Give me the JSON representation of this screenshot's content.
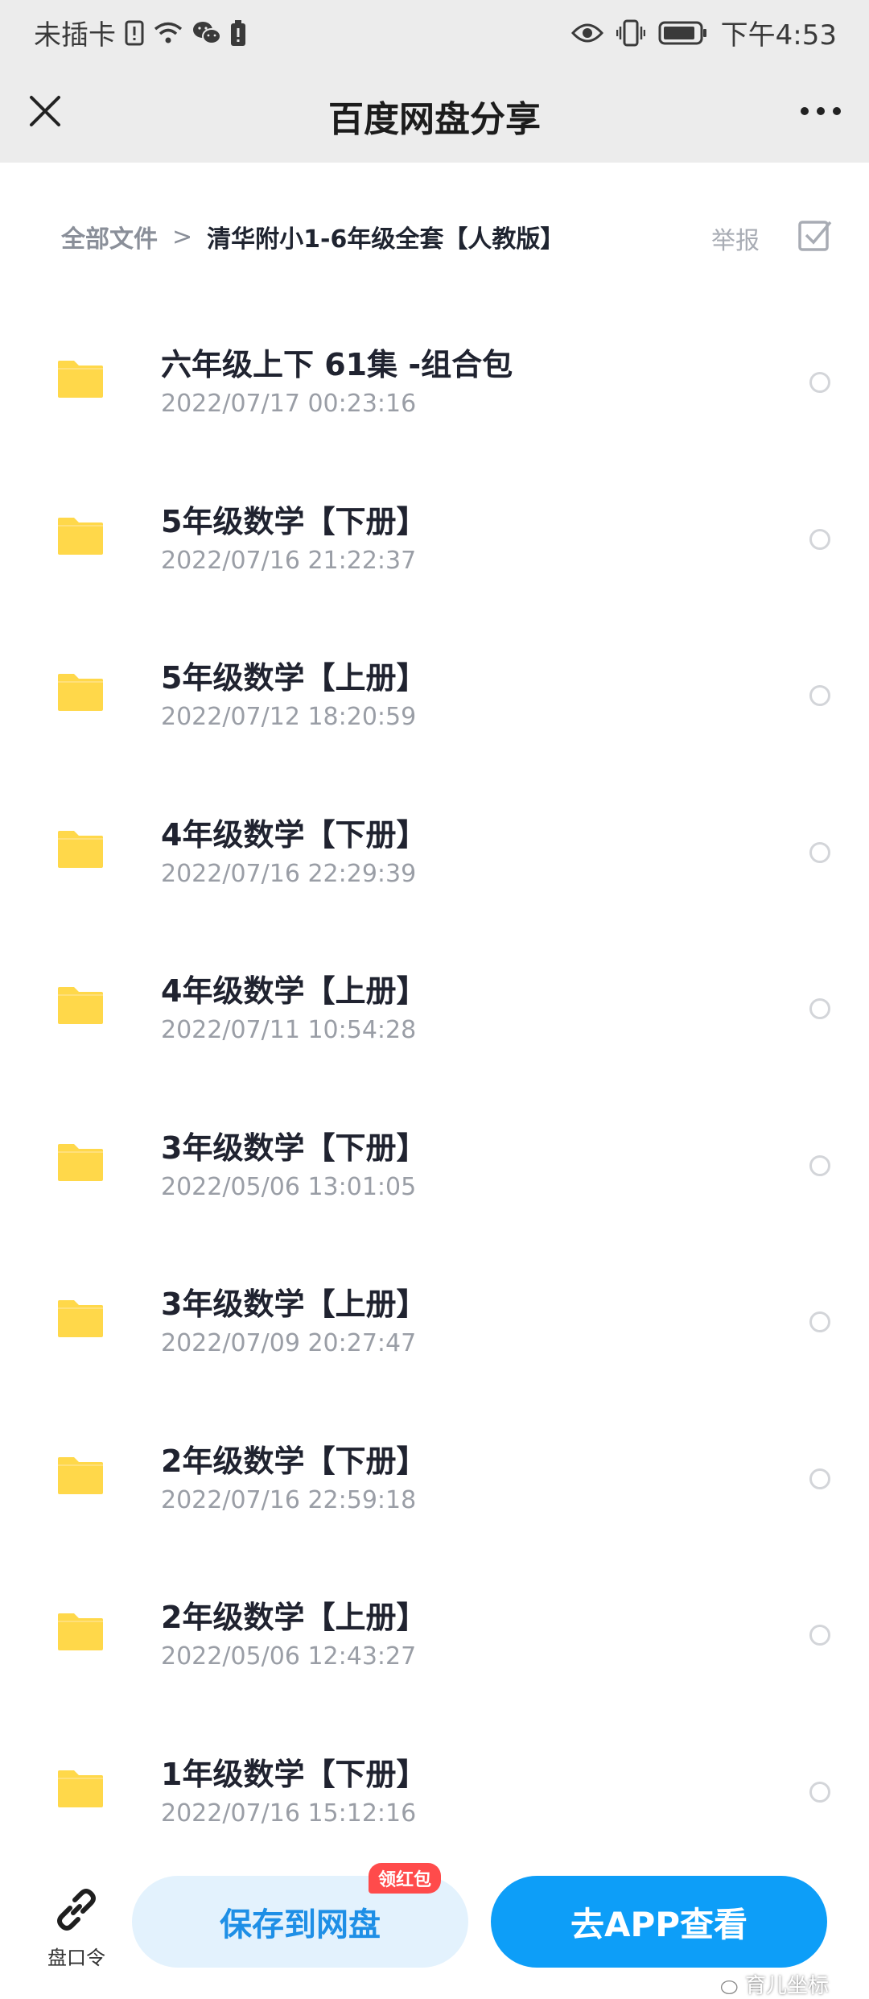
{
  "status_bar": {
    "carrier": "未插卡",
    "time": "下午4:53",
    "icons": [
      "sim-alert-icon",
      "wifi-icon",
      "wechat-icon",
      "battery-saver-icon",
      "eye-icon",
      "vibrate-icon",
      "battery-icon"
    ]
  },
  "header": {
    "title": "百度网盘分享",
    "close_icon": "close-icon",
    "more_icon": "more-icon"
  },
  "breadcrumb": {
    "root": "全部文件",
    "separator": ">",
    "current": "清华附小1-6年级全套【人教版】",
    "report": "举报"
  },
  "files": [
    {
      "name": "六年级上下 61集 -组合包",
      "date": "2022/07/17 00:23:16"
    },
    {
      "name": "5年级数学【下册】",
      "date": "2022/07/16 21:22:37"
    },
    {
      "name": "5年级数学【上册】",
      "date": "2022/07/12 18:20:59"
    },
    {
      "name": "4年级数学【下册】",
      "date": "2022/07/16 22:29:39"
    },
    {
      "name": "4年级数学【上册】",
      "date": "2022/07/11 10:54:28"
    },
    {
      "name": "3年级数学【下册】",
      "date": "2022/05/06 13:01:05"
    },
    {
      "name": "3年级数学【上册】",
      "date": "2022/07/09 20:27:47"
    },
    {
      "name": "2年级数学【下册】",
      "date": "2022/07/16 22:59:18"
    },
    {
      "name": "2年级数学【上册】",
      "date": "2022/05/06 12:43:27"
    },
    {
      "name": "1年级数学【下册】",
      "date": "2022/07/16 15:12:16"
    }
  ],
  "bottom_bar": {
    "link_cmd_label": "盘口令",
    "save_button": "保存到网盘",
    "badge": "领红包",
    "app_button": "去APP查看"
  },
  "watermark": "育儿坐标",
  "colors": {
    "accent": "#0d9ef8",
    "folder": "#ffd84a",
    "badge": "#ff4b4b"
  }
}
